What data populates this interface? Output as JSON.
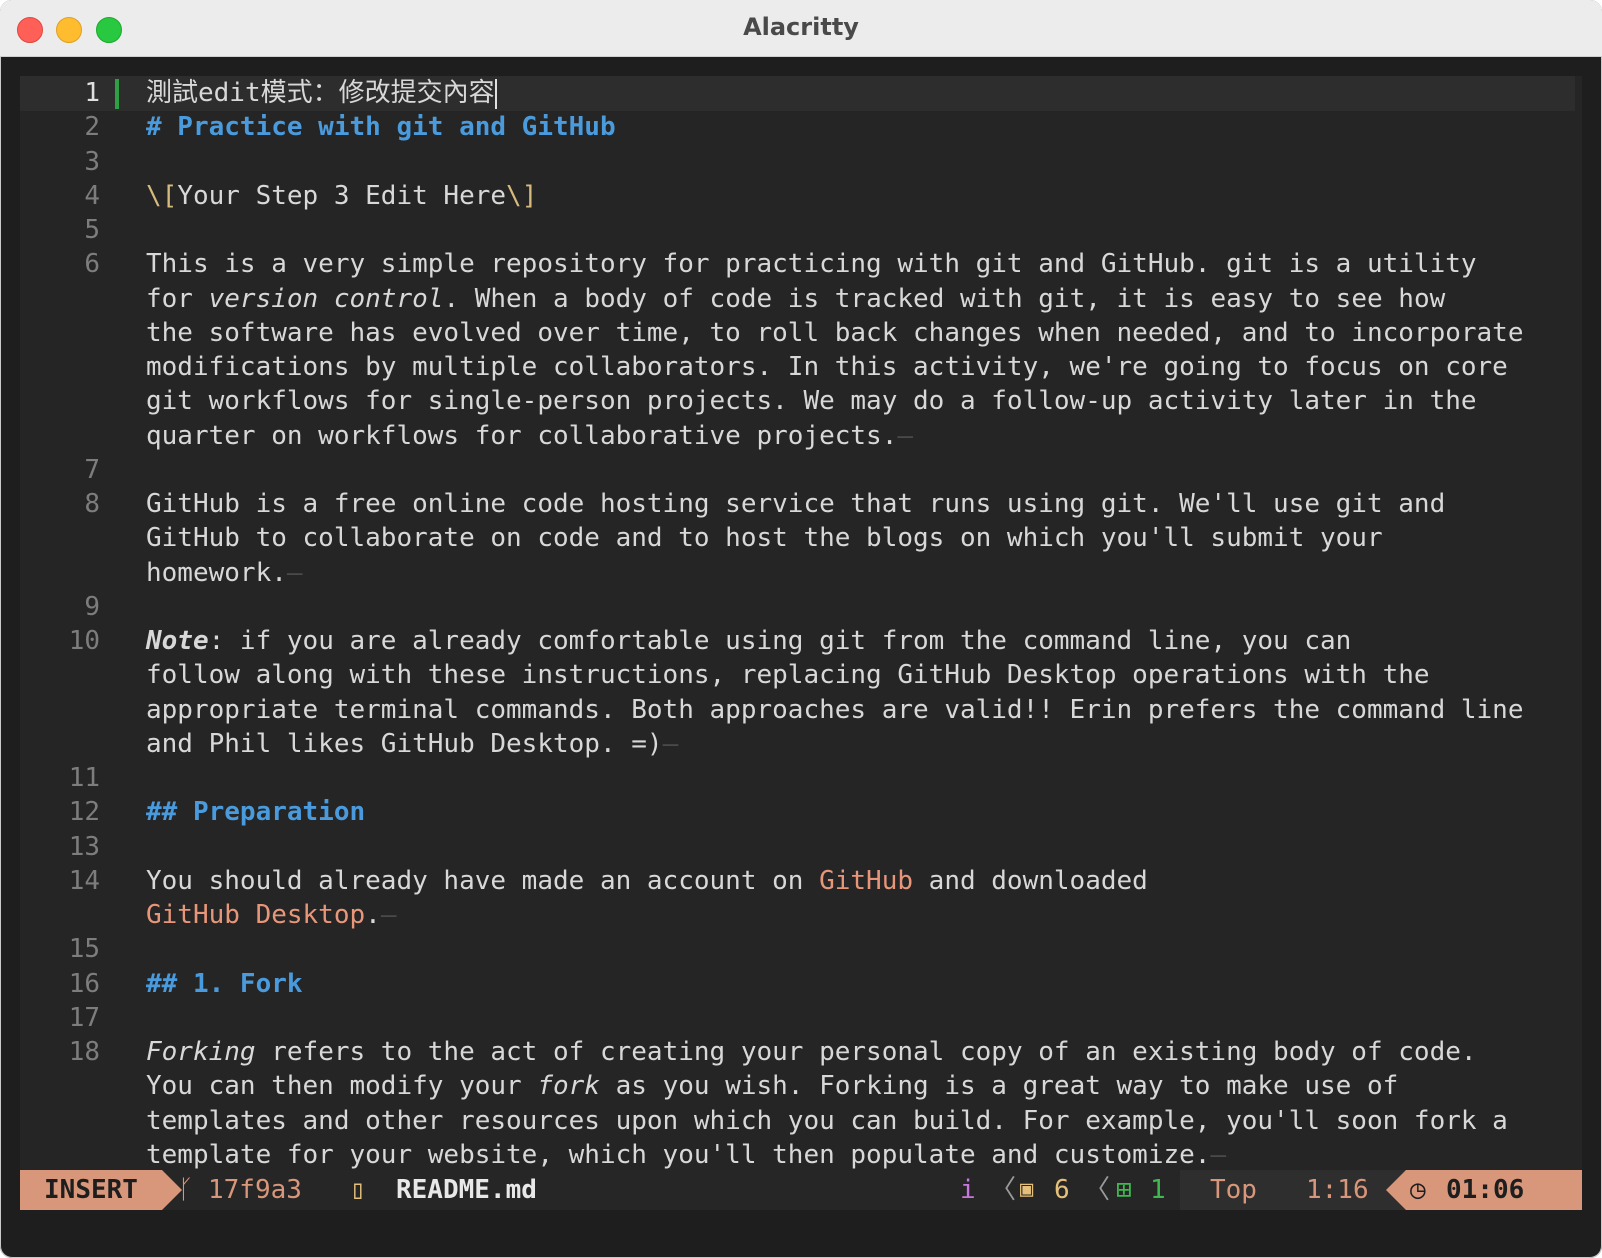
{
  "window": {
    "title": "Alacritty"
  },
  "editor": {
    "lines": [
      {
        "num": "1",
        "rows": [
          "測試edit模式：修改提交內容"
        ]
      },
      {
        "num": "2",
        "rows": [
          "# Practice with git and GitHub"
        ]
      },
      {
        "num": "3",
        "rows": [
          ""
        ]
      },
      {
        "num": "4",
        "rows": [
          "\\[Your Step 3 Edit Here\\]"
        ]
      },
      {
        "num": "5",
        "rows": [
          ""
        ]
      },
      {
        "num": "6",
        "rows": [
          "This is a very simple repository for practicing with git and GitHub. git is a utility",
          "for version control. When a body of code is tracked with git, it is easy to see how",
          "the software has evolved over time, to roll back changes when needed, and to incorporate",
          "modifications by multiple collaborators. In this activity, we're going to focus on core",
          "git workflows for single-person projects. We may do a follow-up activity later in the",
          "quarter on workflows for collaborative projects."
        ]
      },
      {
        "num": "7",
        "rows": [
          ""
        ]
      },
      {
        "num": "8",
        "rows": [
          "GitHub is a free online code hosting service that runs using git. We'll use git and",
          "GitHub to collaborate on code and to host the blogs on which you'll submit your",
          "homework."
        ]
      },
      {
        "num": "9",
        "rows": [
          ""
        ]
      },
      {
        "num": "10",
        "rows": [
          "Note: if you are already comfortable using git from the command line, you can",
          "follow along with these instructions, replacing GitHub Desktop operations with the",
          "appropriate terminal commands. Both approaches are valid!! Erin prefers the command line",
          "and Phil likes GitHub Desktop. =)"
        ]
      },
      {
        "num": "11",
        "rows": [
          ""
        ]
      },
      {
        "num": "12",
        "rows": [
          "## Preparation"
        ]
      },
      {
        "num": "13",
        "rows": [
          ""
        ]
      },
      {
        "num": "14",
        "rows": [
          "You should already have made an account on GitHub and downloaded",
          "GitHub Desktop."
        ]
      },
      {
        "num": "15",
        "rows": [
          ""
        ]
      },
      {
        "num": "16",
        "rows": [
          "## 1. Fork"
        ]
      },
      {
        "num": "17",
        "rows": [
          ""
        ]
      },
      {
        "num": "18",
        "rows": [
          "Forking refers to the act of creating your personal copy of an existing body of code.",
          "You can then modify your fork as you wish. Forking is a great way to make use of",
          "templates and other resources upon which you can build. For example, you'll soon fork a",
          "template for your website, which you'll then populate and customize."
        ]
      }
    ]
  },
  "statusline": {
    "mode": "INSERT",
    "branch_icon": "git-branch-icon",
    "commit": "17f9a3",
    "file_icon": "markdown-file-icon",
    "filename": "README.md",
    "encoding": "i",
    "package_icon": "package-icon",
    "package_count": "6",
    "added_icon": "plus-square-icon",
    "added_count": "1",
    "scroll": "Top",
    "position": "1:16",
    "clock_icon": "clock-icon",
    "time": "01:06"
  }
}
